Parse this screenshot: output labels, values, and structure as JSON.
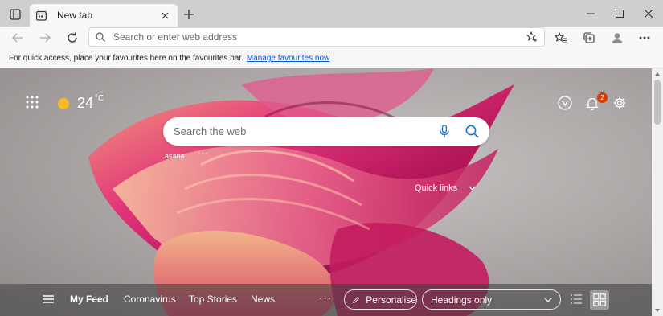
{
  "tabs": [
    {
      "title": "New tab",
      "icon": "new-tab-page-icon",
      "active": true
    }
  ],
  "toolbar": {
    "address_placeholder": "Search or enter web address",
    "address_value": ""
  },
  "favourites_bar": {
    "message": "For quick access, place your favourites here on the favourites bar.",
    "link": "Manage favourites now"
  },
  "weather": {
    "temperature": "24",
    "unit": "°C",
    "icon": "sun-icon"
  },
  "notifications": {
    "count": "2"
  },
  "search": {
    "placeholder": "Search the web"
  },
  "quick_links": {
    "items": [
      {
        "label": "asana"
      }
    ],
    "more": "···",
    "toggle_label": "Quick links"
  },
  "feed": {
    "items": [
      {
        "label": "My Feed",
        "active": true
      },
      {
        "label": "Coronavirus",
        "active": false
      },
      {
        "label": "Top Stories",
        "active": false
      },
      {
        "label": "News",
        "active": false
      }
    ],
    "more": "···",
    "personalise_label": "Personalise",
    "layout_select": {
      "value": "Headings only"
    }
  },
  "colors": {
    "accent_link": "#0b57d0",
    "badge": "#d83b01",
    "sun": "#f7b92b"
  }
}
